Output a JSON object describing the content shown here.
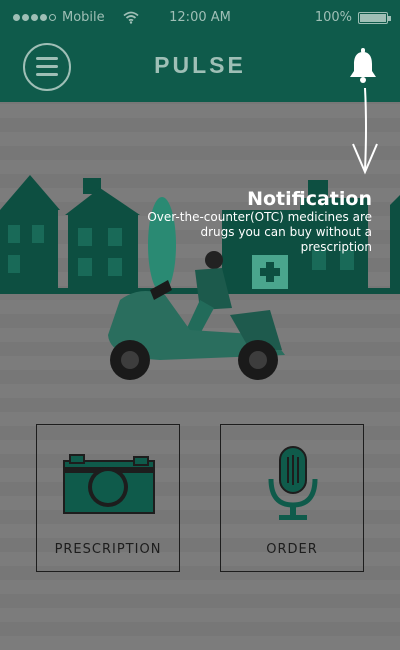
{
  "status_bar": {
    "carrier": "Mobile",
    "time": "12:00 AM",
    "battery": "100%"
  },
  "header": {
    "title": "PULSE"
  },
  "notification_tip": {
    "title": "Notification",
    "text": "Over-the-counter(OTC) medicines are drugs you can buy without a prescription"
  },
  "actions": {
    "prescription_label": "PRESCRIPTION",
    "order_label": "ORDER"
  },
  "colors": {
    "brand": "#0f5b4b",
    "accent": "#9fbfb6",
    "overlay": "#7b7b7b"
  },
  "icons": {
    "menu": "hamburger-menu-icon",
    "notification": "bell-icon",
    "prescription": "camera-icon",
    "order": "microphone-icon"
  }
}
